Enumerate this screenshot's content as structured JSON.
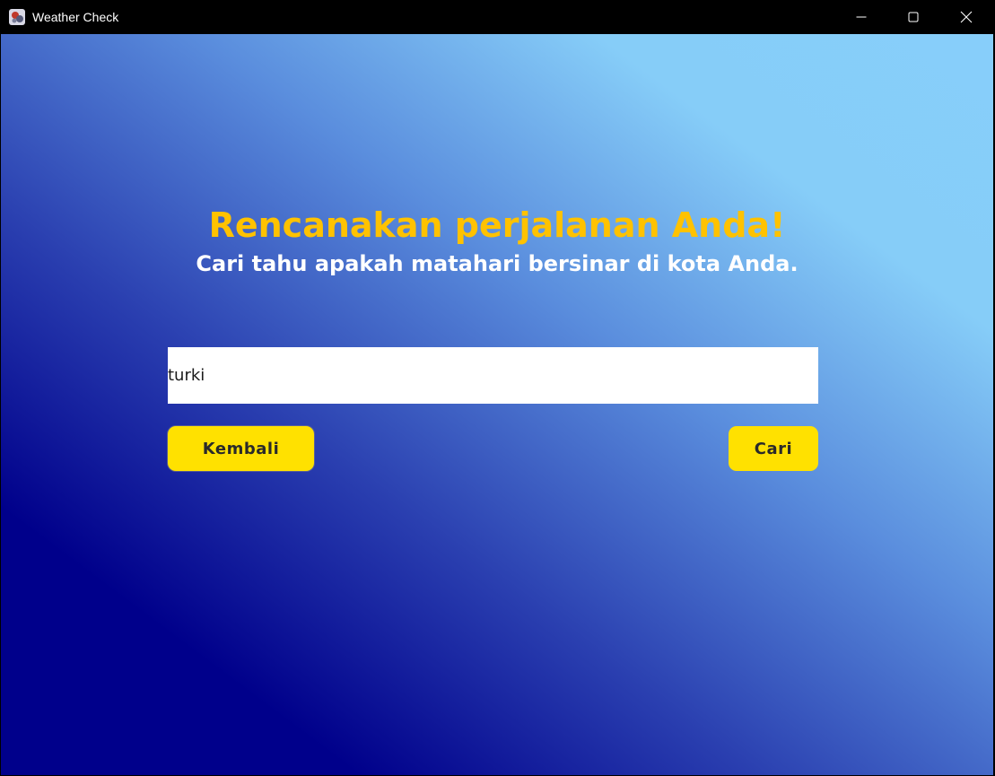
{
  "window": {
    "title": "Weather Check"
  },
  "hero": {
    "headline": "Rencanakan perjalanan Anda!",
    "subheadline": "Cari tahu apakah matahari bersinar di kota Anda."
  },
  "search": {
    "value": "turki"
  },
  "buttons": {
    "back_label": "Kembali",
    "search_label": "Cari"
  },
  "colors": {
    "headline": "#ffc200",
    "button": "#ffe100",
    "gradient_dark": "#00008b",
    "gradient_light": "#87cefa"
  },
  "icons": {
    "app": "app-icon",
    "minimize": "minimize-icon",
    "maximize": "maximize-icon",
    "close": "close-icon"
  }
}
